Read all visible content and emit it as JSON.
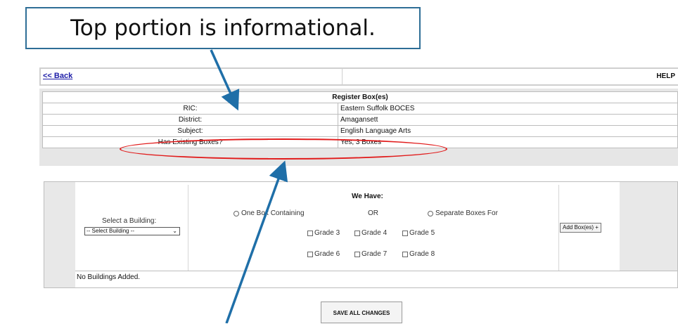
{
  "callout": {
    "text": "Top portion is informational."
  },
  "nav": {
    "back_label": "<< Back",
    "help_label": "HELP"
  },
  "register": {
    "title": "Register Box(es)",
    "rows": [
      {
        "label": "RIC:",
        "value": "Eastern Suffolk BOCES"
      },
      {
        "label": "District:",
        "value": "Amagansett"
      },
      {
        "label": "Subject:",
        "value": "English Language Arts"
      },
      {
        "label": "Has Existing Boxes?",
        "value": "Yes, 3 Boxes"
      }
    ]
  },
  "form": {
    "select_building_label": "Select a Building:",
    "select_building_value": "-- Select Building --",
    "we_have_label": "We Have:",
    "option_one_box": "One Box Containing",
    "or_label": "OR",
    "option_separate": "Separate Boxes For",
    "grades": [
      "Grade 3",
      "Grade 4",
      "Grade 5",
      "Grade 6",
      "Grade 7",
      "Grade 8"
    ],
    "add_button": "Add Box(es) +",
    "no_buildings": "No Buildings Added."
  },
  "save_button": "SAVE ALL CHANGES",
  "colors": {
    "callout_border": "#2e6e96",
    "arrow": "#1f6fa8",
    "highlight_oval": "#e11b1b"
  }
}
